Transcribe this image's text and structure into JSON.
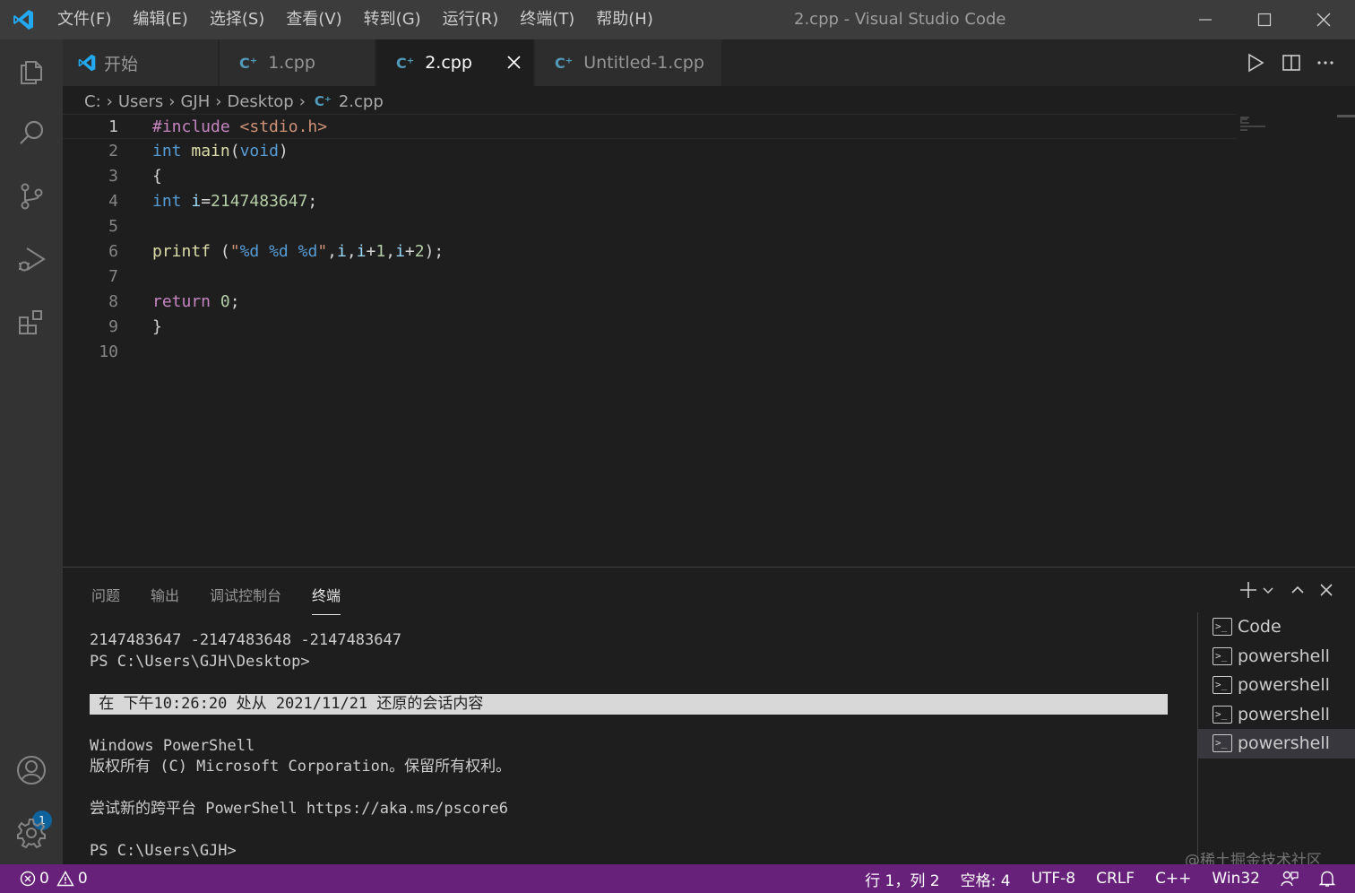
{
  "menu": [
    "文件(F)",
    "编辑(E)",
    "选择(S)",
    "查看(V)",
    "转到(G)",
    "运行(R)",
    "终端(T)",
    "帮助(H)"
  ],
  "window_title": "2.cpp - Visual Studio Code",
  "colors": {
    "accent": "#007acc",
    "statusbar": "#68217a",
    "titlebar": "#3c3c3c",
    "activity": "#333333",
    "editor_bg": "#1e1e1e"
  },
  "tabs": [
    {
      "label": "开始",
      "icon": "vscode-logo-icon"
    },
    {
      "label": "1.cpp",
      "icon": "cpp-file-icon"
    },
    {
      "label": "2.cpp",
      "icon": "cpp-file-icon",
      "active": true
    },
    {
      "label": "Untitled-1.cpp",
      "icon": "cpp-file-icon"
    }
  ],
  "breadcrumb": [
    "C:",
    "Users",
    "GJH",
    "Desktop",
    "2.cpp"
  ],
  "editor": {
    "line_numbers": [
      "1",
      "2",
      "3",
      "4",
      "5",
      "6",
      "7",
      "8",
      "9",
      "10"
    ],
    "lines": [
      "#include <stdio.h>",
      "int main(void)",
      "{",
      "int i=2147483647;",
      "",
      "printf (\"%d %d %d\",i,i+1,i+2);",
      "",
      "return 0;",
      "}",
      ""
    ]
  },
  "panel": {
    "tabs": [
      "问题",
      "输出",
      "调试控制台",
      "终端"
    ],
    "active_tab": "终端",
    "terminal_lines": [
      "2147483647 -2147483648 -2147483647",
      "PS C:\\Users\\GJH\\Desktop>",
      "",
      " 在 下午10:26:20 处从 2021/11/21 还原的会话内容",
      "",
      "Windows PowerShell",
      "版权所有 (C) Microsoft Corporation。保留所有权利。",
      "",
      "尝试新的跨平台 PowerShell https://aka.ms/pscore6",
      "",
      "PS C:\\Users\\GJH>"
    ],
    "terminal_instances": [
      "Code",
      "powershell",
      "powershell",
      "powershell",
      "powershell"
    ]
  },
  "accounts_badge": "1",
  "status": {
    "errors": "0",
    "warnings": "0",
    "position": "行 1，列 2",
    "spaces": "空格: 4",
    "encoding": "UTF-8",
    "eol": "CRLF",
    "language": "C++",
    "platform": "Win32"
  },
  "watermark": "@稀土掘金技术社区"
}
